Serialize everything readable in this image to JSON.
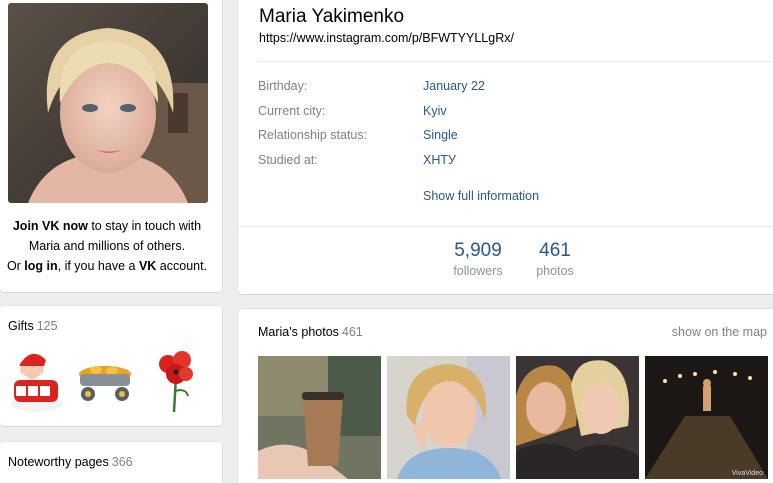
{
  "sidebar": {
    "join": {
      "join_vk": "Join VK now",
      "line1_rest": " to stay in touch with",
      "line2": "Maria and millions of others.",
      "or": "Or ",
      "login": "log in",
      "mid": ", if you have a ",
      "vk": "VK",
      "end": " account."
    },
    "gifts": {
      "title": "Gifts",
      "count": "125"
    },
    "noteworthy": {
      "title": "Noteworthy pages",
      "count": "366"
    }
  },
  "profile": {
    "name": "Maria Yakimenko",
    "status": "https://www.instagram.com/p/BFWTYYLLgRx/",
    "info": [
      {
        "label": "Birthday:",
        "value": "January 22"
      },
      {
        "label": "Current city:",
        "value": "Kyiv"
      },
      {
        "label": "Relationship status:",
        "value": "Single"
      },
      {
        "label": "Studied at:",
        "value": "ХНТУ"
      }
    ],
    "show_full": "Show full information",
    "counters": [
      {
        "num": "5,909",
        "label": "followers"
      },
      {
        "num": "461",
        "label": "photos"
      }
    ]
  },
  "photos": {
    "title": "Maria's photos",
    "count": "461",
    "map_link": "show on the map",
    "watermark": "VivaVideo"
  },
  "colors": {
    "link": "#2a5885",
    "muted": "#828282",
    "background": "#edeef0"
  }
}
